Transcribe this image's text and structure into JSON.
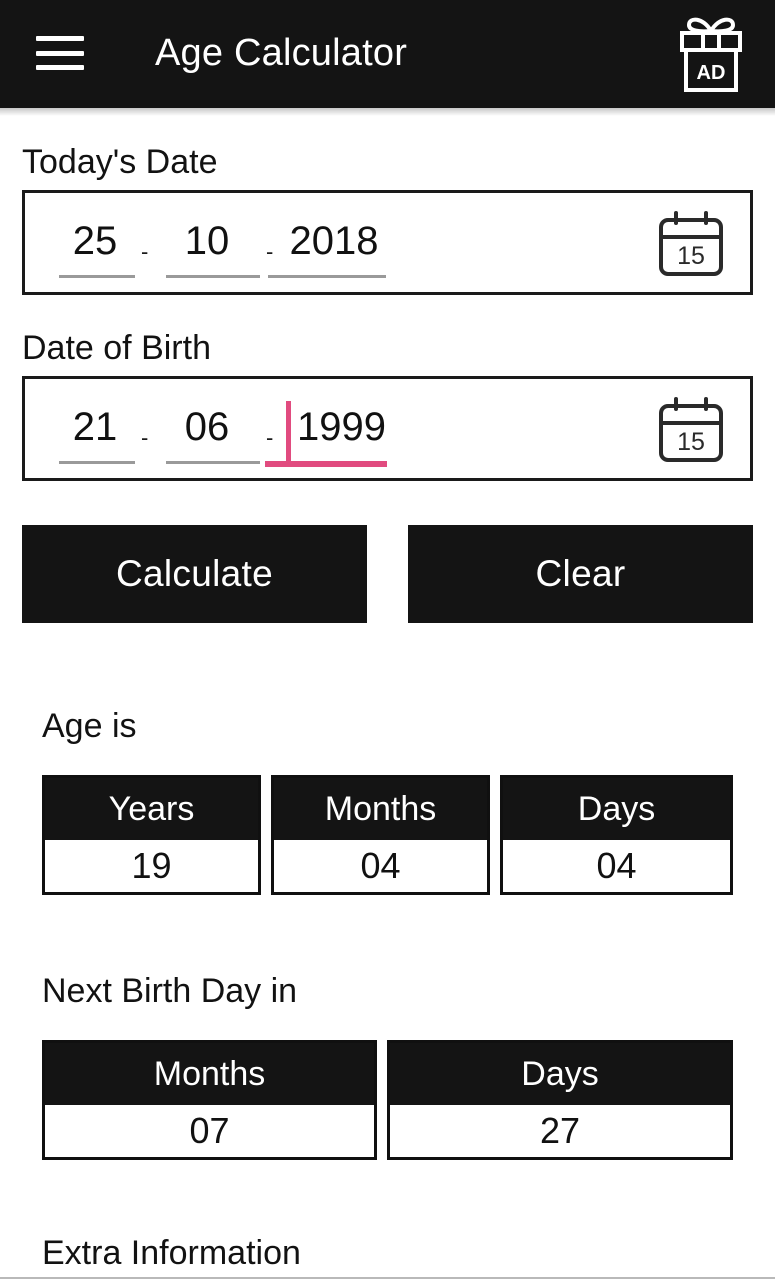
{
  "appbar": {
    "menu_icon": "hamburger-menu-icon",
    "title": "Age Calculator",
    "ad_icon": "gift-ad-icon",
    "ad_icon_label": "AD",
    "background": "#141414",
    "text_color": "#ffffff"
  },
  "today": {
    "label": "Today's Date",
    "day": "25",
    "month": "10",
    "year": "2018",
    "separator": "-",
    "calendar_icon": "calendar-icon",
    "calendar_icon_day": "15"
  },
  "dob": {
    "label": "Date of Birth",
    "day": "21",
    "month": "06",
    "year": "1999",
    "separator": "-",
    "focused_segment": "year",
    "focus_color": "#e14b7f",
    "calendar_icon": "calendar-icon",
    "calendar_icon_day": "15"
  },
  "actions": {
    "calculate_label": "Calculate",
    "clear_label": "Clear"
  },
  "age_result": {
    "title": "Age is",
    "columns": [
      "Years",
      "Months",
      "Days"
    ],
    "values": [
      "19",
      "04",
      "04"
    ]
  },
  "next_birthday": {
    "title": "Next Birth Day in",
    "columns": [
      "Months",
      "Days"
    ],
    "values": [
      "07",
      "27"
    ]
  },
  "extra": {
    "title": "Extra Information"
  }
}
